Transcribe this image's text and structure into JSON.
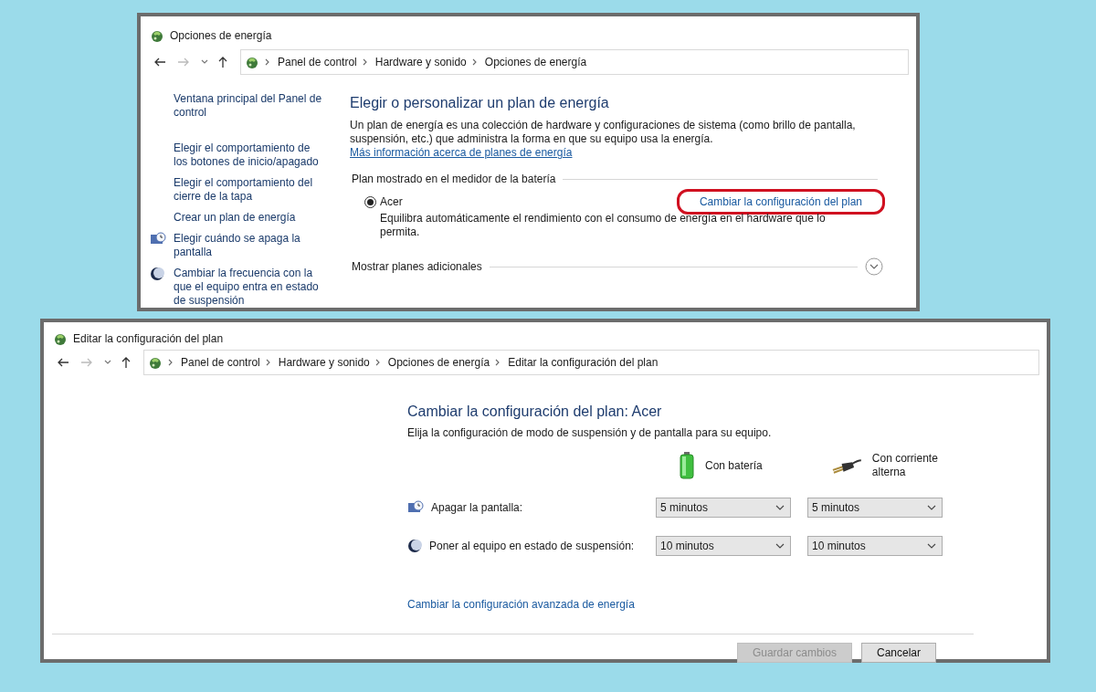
{
  "power_options": {
    "title": "Opciones de energía",
    "nav": {
      "back_enabled": true,
      "forward_enabled": false
    },
    "breadcrumb": [
      "Panel de control",
      "Hardware y sonido",
      "Opciones de energía"
    ],
    "sidebar": [
      {
        "label": "Ventana principal del Panel de control",
        "kind": "plain"
      },
      {
        "label": "Elegir el comportamiento de los botones de inicio/apagado",
        "kind": "plain"
      },
      {
        "label": "Elegir el comportamiento del cierre de la tapa",
        "kind": "plain"
      },
      {
        "label": "Crear un plan de energía",
        "kind": "plain"
      },
      {
        "label": "Elegir cuándo se apaga la pantalla",
        "kind": "display"
      },
      {
        "label": "Cambiar la frecuencia con la que el equipo entra en estado de suspensión",
        "kind": "sleep"
      }
    ],
    "heading": "Elegir o personalizar un plan de energía",
    "description": "Un plan de energía es una colección de hardware y configuraciones de sistema (como brillo de pantalla, suspensión, etc.) que administra la forma en que su equipo usa la energía.",
    "more_info_link": "Más información acerca de planes de energía",
    "group_label": "Plan mostrado en el medidor de la batería",
    "plans": [
      {
        "name": "Acer",
        "selected": true,
        "description": "Equilibra automáticamente el rendimiento con el consumo de energía en el hardware que lo permita.",
        "change_link": "Cambiar la configuración del plan",
        "highlighted": true
      }
    ],
    "more_plans": {
      "label": "Mostrar planes adicionales",
      "expanded": false
    }
  },
  "edit_plan": {
    "title": "Editar la configuración del plan",
    "nav": {
      "back_enabled": true,
      "forward_enabled": false
    },
    "breadcrumb": [
      "Panel de control",
      "Hardware y sonido",
      "Opciones de energía",
      "Editar la configuración del plan"
    ],
    "heading": "Cambiar la configuración del plan: Acer",
    "subheading": "Elija la configuración de modo de suspensión y de pantalla para su equipo.",
    "columns": [
      {
        "label": "Con batería",
        "kind": "battery"
      },
      {
        "label": "Con corriente alterna",
        "kind": "ac"
      }
    ],
    "settings": [
      {
        "label": "Apagar la pantalla:",
        "kind": "display",
        "values": [
          "5 minutos",
          "5 minutos"
        ]
      },
      {
        "label": "Poner al equipo en estado de suspensión:",
        "kind": "sleep",
        "values": [
          "10 minutos",
          "10 minutos"
        ]
      }
    ],
    "advanced_link": "Cambiar la configuración avanzada de energía",
    "buttons": [
      {
        "label": "Guardar cambios",
        "disabled": true
      },
      {
        "label": "Cancelar",
        "disabled": false
      }
    ]
  }
}
